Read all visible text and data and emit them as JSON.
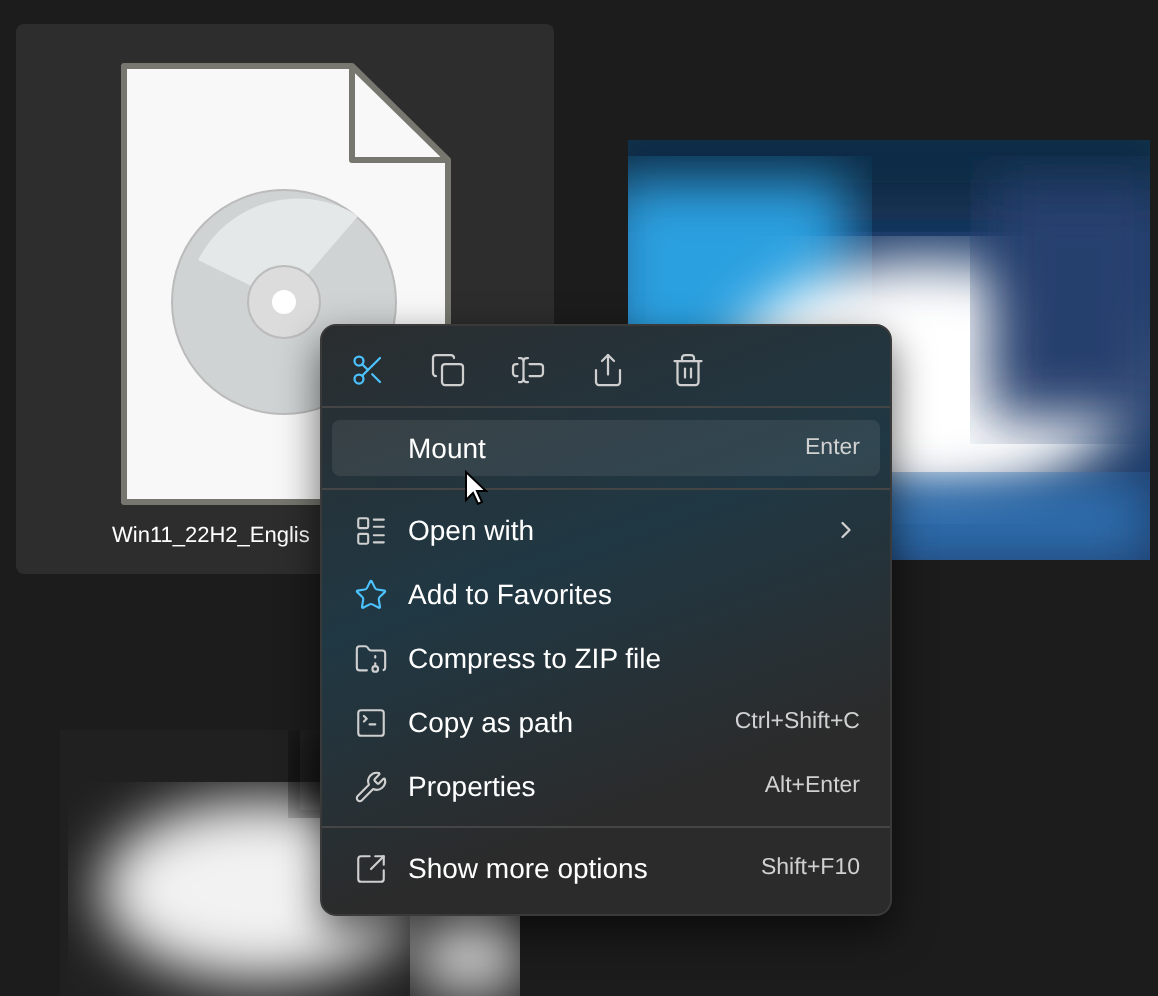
{
  "file_tile": {
    "label": "Win11_22H2_Englis",
    "selected": true
  },
  "context_menu": {
    "sections": [
      [
        {
          "label": "Mount",
          "shortcut": "Enter",
          "selected": true
        }
      ],
      [
        {
          "label": "Open with",
          "submenu": true,
          "selected": false
        },
        {
          "label": "Add to Favorites",
          "selected": false
        },
        {
          "label": "Compress to ZIP file",
          "selected": false
        },
        {
          "label": "Copy as path",
          "shortcut": "Ctrl+Shift+C",
          "selected": false
        },
        {
          "label": "Properties",
          "shortcut": "Alt+Enter",
          "selected": false
        }
      ],
      [
        {
          "label": "Show more options",
          "shortcut": "Shift+F10",
          "selected": false
        }
      ]
    ]
  }
}
